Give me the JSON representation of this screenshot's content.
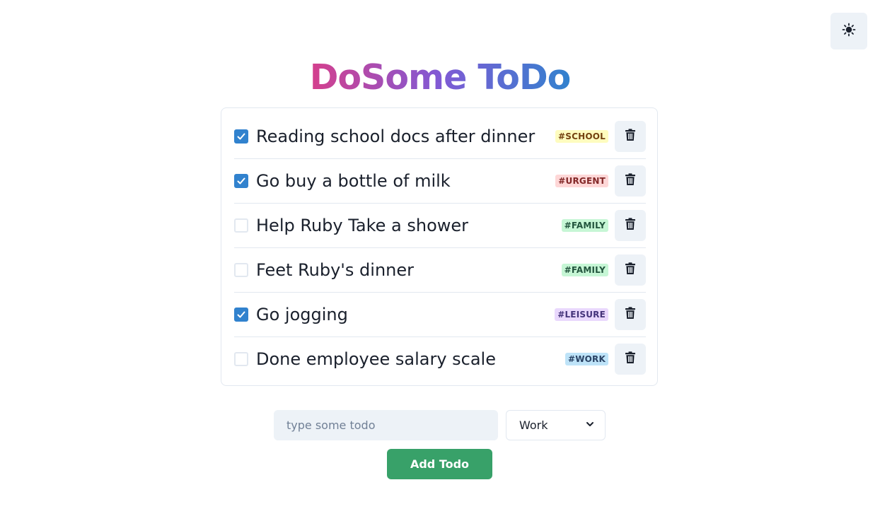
{
  "app": {
    "title": "DoSome ToDo",
    "theme_toggle_icon": "sun-icon"
  },
  "todos": [
    {
      "text": "Reading school docs after dinner",
      "done": true,
      "tag": "#SCHOOL",
      "tag_bg": "#fefcbf",
      "tag_fg": "#744210"
    },
    {
      "text": "Go buy a bottle of milk",
      "done": true,
      "tag": "#URGENT",
      "tag_bg": "#fed7d7",
      "tag_fg": "#822727"
    },
    {
      "text": "Help Ruby Take a shower",
      "done": false,
      "tag": "#FAMILY",
      "tag_bg": "#c6f6d5",
      "tag_fg": "#22543d"
    },
    {
      "text": "Feet Ruby's dinner",
      "done": false,
      "tag": "#FAMILY",
      "tag_bg": "#c6f6d5",
      "tag_fg": "#22543d"
    },
    {
      "text": "Go jogging",
      "done": true,
      "tag": "#LEISURE",
      "tag_bg": "#e9d8fd",
      "tag_fg": "#44337a"
    },
    {
      "text": "Done employee salary scale",
      "done": false,
      "tag": "#WORK",
      "tag_bg": "#bee3f8",
      "tag_fg": "#2a4365"
    }
  ],
  "icons": {
    "checkbox_checked": "check-icon",
    "delete": "trash-icon",
    "select_arrow": "chevron-down-icon"
  },
  "form": {
    "input_value": "",
    "input_placeholder": "type some todo",
    "category_selected": "Work",
    "add_button_label": "Add Todo"
  },
  "colors": {
    "accent": "#3182ce",
    "add_button": "#38a169",
    "title_gradient": [
      "#d53f8c",
      "#805ad5",
      "#3182ce"
    ]
  }
}
